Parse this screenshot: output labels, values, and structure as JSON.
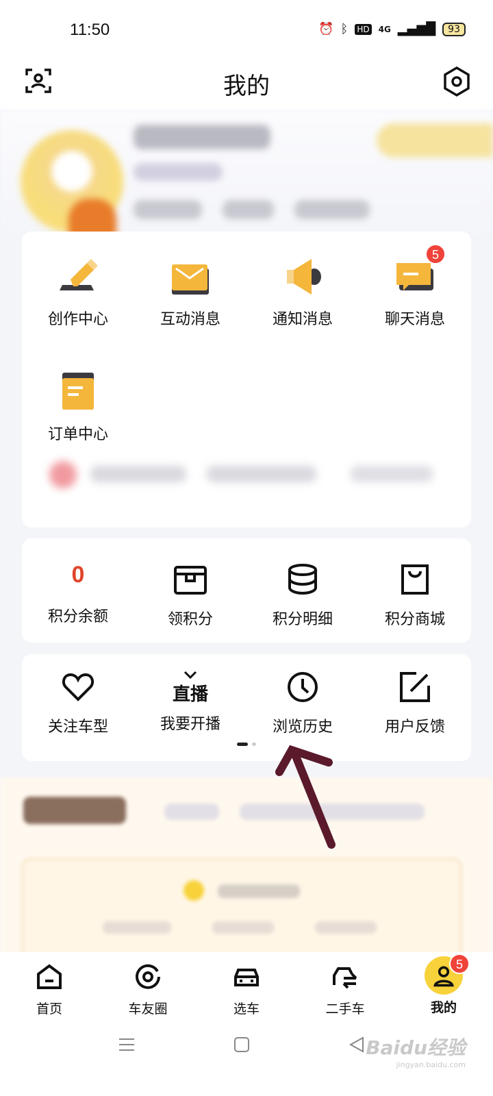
{
  "status": {
    "time": "11:50",
    "network": "4G",
    "hd": "HD",
    "battery": "93"
  },
  "header": {
    "title": "我的"
  },
  "messages": [
    {
      "label": "创作中心",
      "icon": "pencil-icon"
    },
    {
      "label": "互动消息",
      "icon": "envelope-icon"
    },
    {
      "label": "通知消息",
      "icon": "megaphone-icon"
    },
    {
      "label": "聊天消息",
      "icon": "chat-bubble-icon",
      "badge": "5"
    },
    {
      "label": "订单中心",
      "icon": "order-list-icon"
    }
  ],
  "points": {
    "balance_value": "0",
    "items": [
      {
        "label": "积分余额"
      },
      {
        "label": "领积分",
        "icon": "gift-box-icon"
      },
      {
        "label": "积分明细",
        "icon": "coin-stack-icon"
      },
      {
        "label": "积分商城",
        "icon": "shopping-bag-icon"
      }
    ]
  },
  "tools": [
    {
      "label": "关注车型",
      "icon": "heart-icon"
    },
    {
      "label": "我要开播",
      "icon": "live-tv-icon",
      "icon_text": "直播"
    },
    {
      "label": "浏览历史",
      "icon": "clock-icon"
    },
    {
      "label": "用户反馈",
      "icon": "edit-square-icon"
    }
  ],
  "nav": [
    {
      "label": "首页",
      "icon": "home-icon"
    },
    {
      "label": "车友圈",
      "icon": "community-icon"
    },
    {
      "label": "选车",
      "icon": "car-icon"
    },
    {
      "label": "二手车",
      "icon": "used-car-icon"
    },
    {
      "label": "我的",
      "icon": "user-icon",
      "badge": "5",
      "active": true
    }
  ],
  "watermark": {
    "brand": "Baidu经验",
    "url": "jingyan.baidu.com"
  },
  "colors": {
    "accent_yellow": "#f8d23a",
    "badge_red": "#f0433a",
    "points_red": "#e0462b",
    "arrow": "#5a1a2c"
  }
}
